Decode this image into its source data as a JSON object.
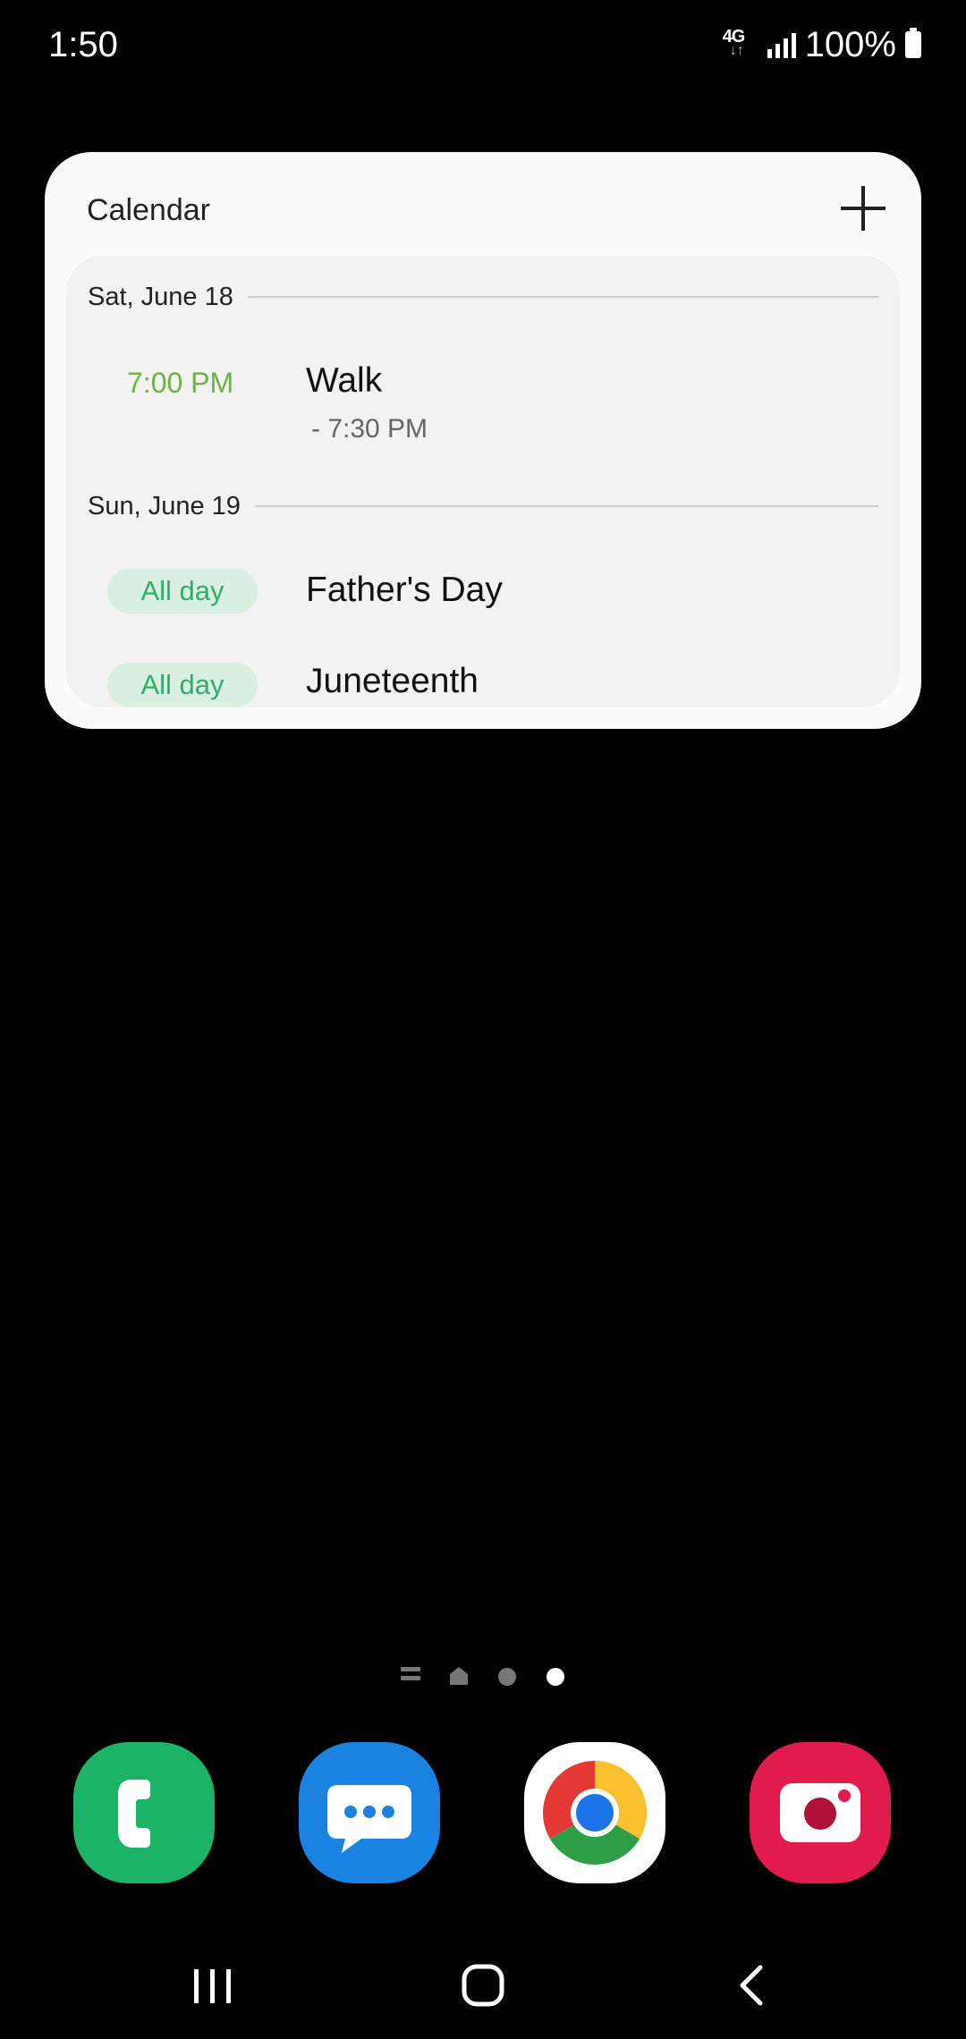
{
  "status_bar": {
    "time": "1:50",
    "network": "4G",
    "battery": "100%"
  },
  "widget": {
    "title": "Calendar",
    "groups": [
      {
        "date": "Sat, June 18",
        "events": [
          {
            "time": "7:00 PM",
            "title": "Walk",
            "end": "- 7:30 PM"
          }
        ]
      },
      {
        "date": "Sun, June 19",
        "events": [
          {
            "time": "All day",
            "title": "Father's Day"
          },
          {
            "time": "All day",
            "title": "Juneteenth"
          }
        ]
      }
    ]
  },
  "colors": {
    "event_time": "#6db33f",
    "allday_text": "#2fae6b",
    "allday_bg": "#d8efe2",
    "phone": "#1db366",
    "messages": "#1a82e0",
    "camera": "#e21b4e"
  },
  "page_indicator": {
    "pages": 2,
    "active_page": 2
  },
  "dock": [
    "phone-icon",
    "messages-icon",
    "chrome-icon",
    "camera-icon"
  ]
}
